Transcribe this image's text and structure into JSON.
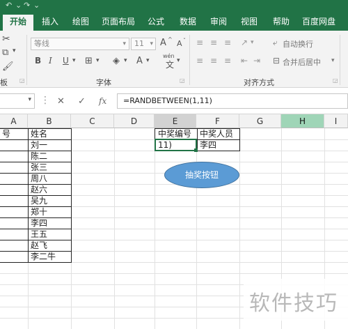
{
  "titlebar": {
    "undo_icon": "undo-icon",
    "redo_icon": "redo-icon"
  },
  "tabs": [
    {
      "label": "开始",
      "active": true
    },
    {
      "label": "插入"
    },
    {
      "label": "绘图"
    },
    {
      "label": "页面布局"
    },
    {
      "label": "公式"
    },
    {
      "label": "数据"
    },
    {
      "label": "审阅"
    },
    {
      "label": "视图"
    },
    {
      "label": "帮助"
    },
    {
      "label": "百度网盘"
    }
  ],
  "ribbon": {
    "font_name": "等线",
    "font_size": "11",
    "font_group_label": "字体",
    "align_group_label": "对齐方式",
    "clipboard_label": "板",
    "bold": "B",
    "italic": "I",
    "underline": "U",
    "grow_font": "A",
    "shrink_font": "A",
    "font_color": "A",
    "phonetic": "wén",
    "wrap_text": "自动换行",
    "merge_center": "合并后居中"
  },
  "formula_bar": {
    "cancel": "✕",
    "enter": "✓",
    "fx": "fx",
    "formula": "=RANDBETWEEN(1,11)"
  },
  "grid": {
    "columns": [
      "A",
      "B",
      "C",
      "D",
      "E",
      "F",
      "G",
      "H",
      "I"
    ],
    "header_B": "姓名",
    "header_A_partial": "号",
    "names": [
      "刘一",
      "陈二",
      "张三",
      "周八",
      "赵六",
      "吴九",
      "郑十",
      "李四",
      "王五",
      "赵飞",
      "李二牛"
    ],
    "e_header": "中奖编号",
    "f_header": "中奖人员",
    "e_value": "11)",
    "f_value": "李四",
    "button_label": "抽奖按钮",
    "watermark": "软件技巧"
  }
}
